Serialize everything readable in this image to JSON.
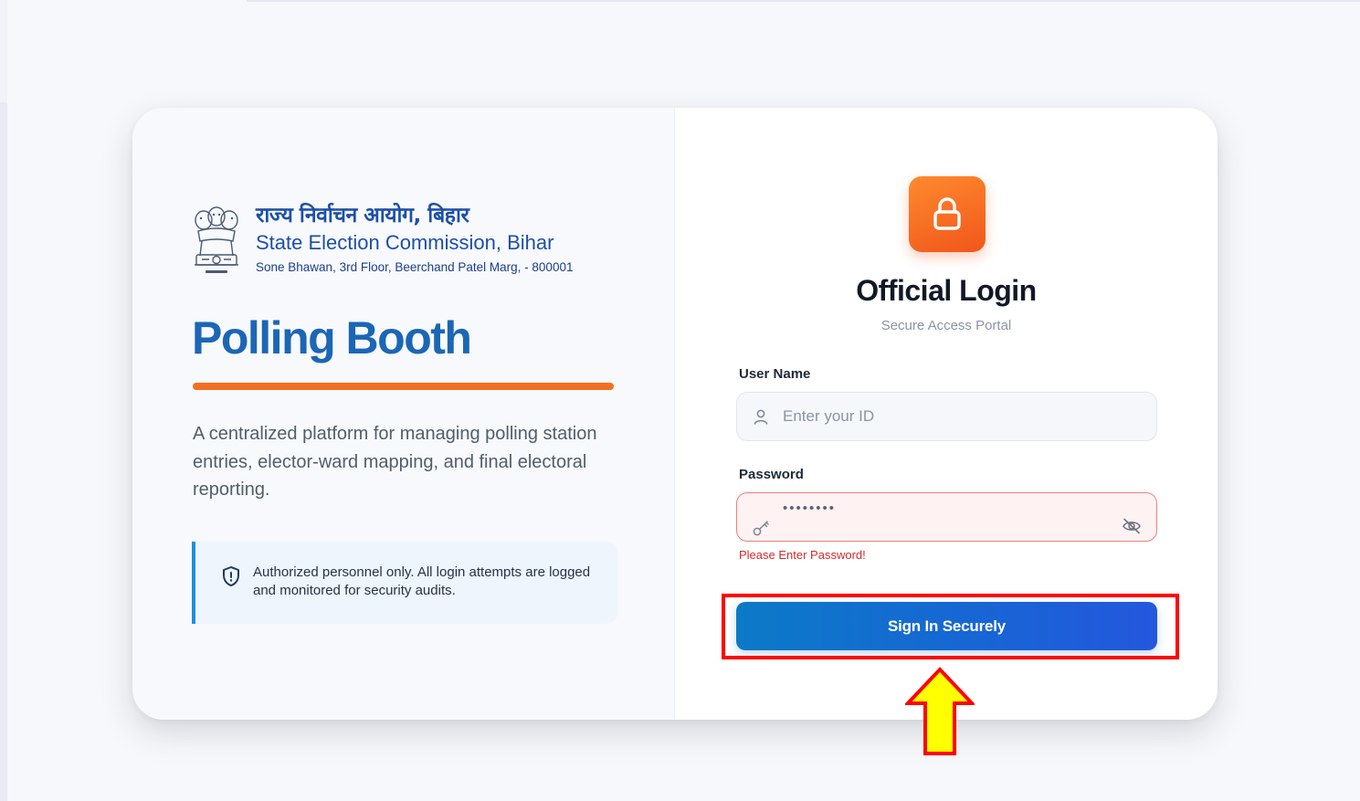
{
  "header": {
    "hindi_name": "राज्य निर्वाचन आयोग, बिहार",
    "english_name": "State Election Commission, Bihar",
    "address": "Sone Bhawan, 3rd Floor, Beerchand Patel Marg, - 800001",
    "emblem_icon": "ashoka-emblem-icon"
  },
  "hero": {
    "title": "Polling Booth",
    "description": "A centralized platform for managing polling station entries, elector-ward mapping, and final electoral reporting.",
    "notice": "Authorized personnel only. All login attempts are logged and monitored for security audits.",
    "notice_icon": "shield-alert-icon"
  },
  "login": {
    "lock_icon": "lock-icon",
    "title": "Official Login",
    "subtitle": "Secure Access Portal",
    "username_label": "User Name",
    "username_placeholder": "Enter your ID",
    "username_value": "",
    "password_label": "Password",
    "password_value": "••••••••",
    "password_error": "Please Enter Password!",
    "submit_label": "Sign In Securely"
  },
  "colors": {
    "brand_blue": "#1b66b5",
    "accent_orange": "#f36f21",
    "error_red": "#dc2626",
    "highlight_red": "#ff0000",
    "arrow_yellow": "#ffff00"
  }
}
